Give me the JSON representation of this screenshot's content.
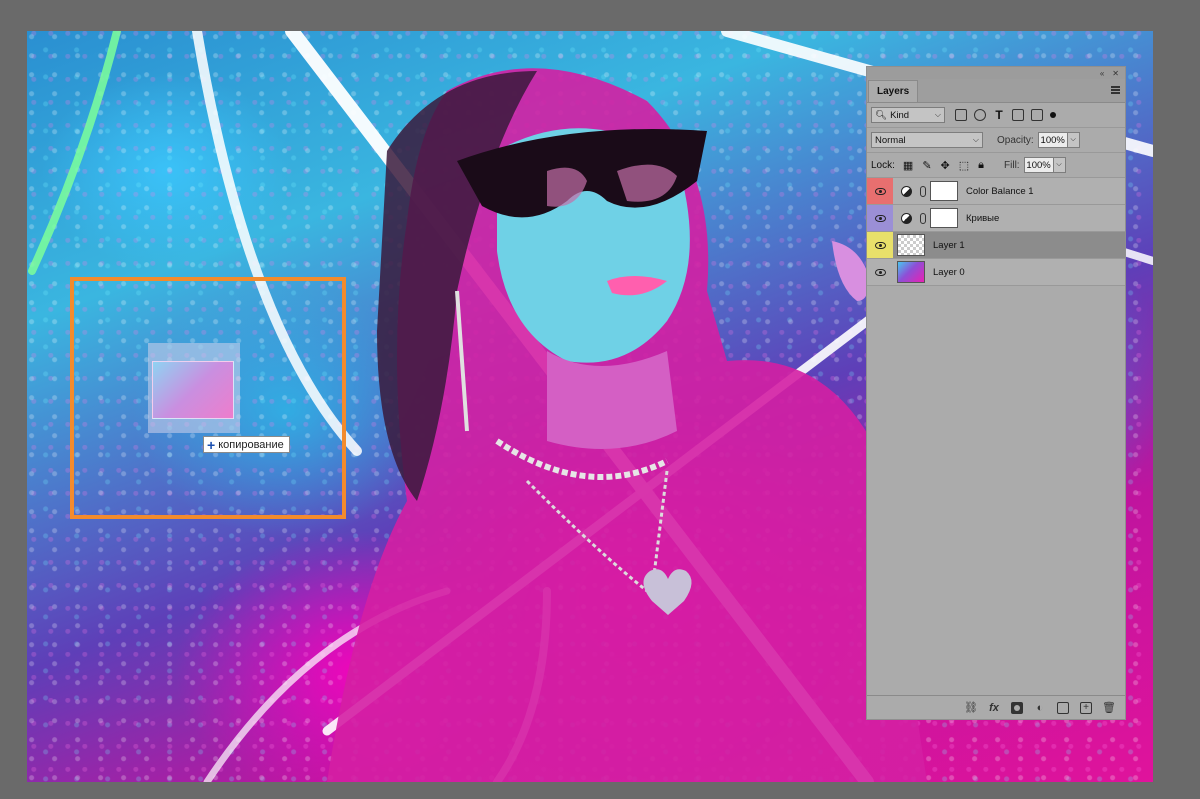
{
  "layers_panel": {
    "tab_label": "Layers",
    "filter": {
      "kind_label": "Kind"
    },
    "blend_mode": "Normal",
    "opacity_label": "Opacity:",
    "opacity_value": "100%",
    "lock_label": "Lock:",
    "fill_label": "Fill:",
    "fill_value": "100%",
    "layers": [
      {
        "name": "Color Balance 1",
        "kind": "adjustment",
        "visible": true,
        "color_tag": "#e86f6f"
      },
      {
        "name": "Кривые",
        "kind": "adjustment",
        "visible": true,
        "color_tag": "#9b8fd6"
      },
      {
        "name": "Layer 1",
        "kind": "pixel",
        "visible": true,
        "color_tag": "#e8e06a",
        "selected": true
      },
      {
        "name": "Layer 0",
        "kind": "pixel",
        "visible": true,
        "color_tag": null
      }
    ]
  },
  "drag_tooltip": {
    "label": "копирование"
  },
  "colors": {
    "drop_zone_border": "#f38b2c",
    "panel_bg": "#ababab",
    "workspace_bg": "#6a6a6a"
  }
}
